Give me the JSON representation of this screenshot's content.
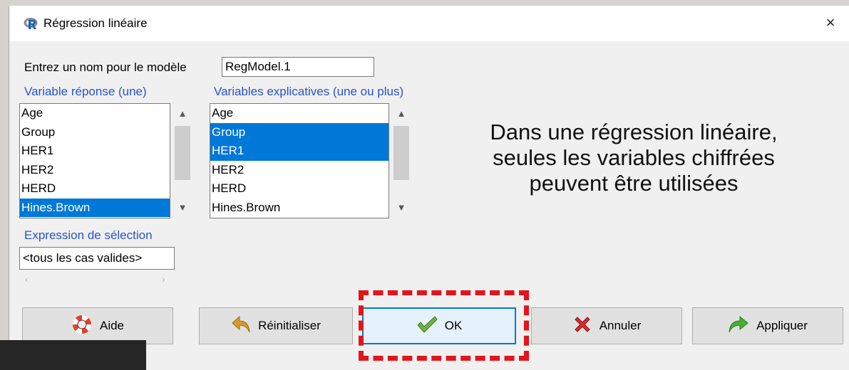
{
  "window": {
    "title": "Régression linéaire",
    "close_symbol": "×"
  },
  "form": {
    "model_name_label": "Entrez un nom pour le modèle",
    "model_name_value": "RegModel.1",
    "response_label": "Variable réponse (une)",
    "explanatory_label": "Variables explicatives (une ou plus)",
    "selection_label": "Expression de sélection",
    "selection_value": "<tous les cas valides>"
  },
  "response_list": [
    {
      "name": "Age",
      "selected": false
    },
    {
      "name": "Group",
      "selected": false
    },
    {
      "name": "HER1",
      "selected": false
    },
    {
      "name": "HER2",
      "selected": false
    },
    {
      "name": "HERD",
      "selected": false
    },
    {
      "name": "Hines.Brown",
      "selected": true
    }
  ],
  "explanatory_list": [
    {
      "name": "Age",
      "selected": false
    },
    {
      "name": "Group",
      "selected": true
    },
    {
      "name": "HER1",
      "selected": true
    },
    {
      "name": "HER2",
      "selected": false
    },
    {
      "name": "HERD",
      "selected": false
    },
    {
      "name": "Hines.Brown",
      "selected": false
    }
  ],
  "annotation": {
    "line1": "Dans une régression linéaire,",
    "line2": "seules les variables chiffrées",
    "line3": "peuvent être utilisées"
  },
  "buttons": {
    "help": "Aide",
    "reset": "Réinitialiser",
    "ok": "OK",
    "cancel": "Annuler",
    "apply": "Appliquer"
  },
  "icons": {
    "app": "r-logo-icon",
    "help": "lifebuoy-icon",
    "reset": "undo-arrow-icon",
    "ok": "checkmark-icon",
    "cancel": "red-x-icon",
    "apply": "redo-arrow-icon"
  },
  "colors": {
    "selection": "#0078d7",
    "label_blue": "#2a53c8",
    "highlight_dash": "#e3141b"
  }
}
